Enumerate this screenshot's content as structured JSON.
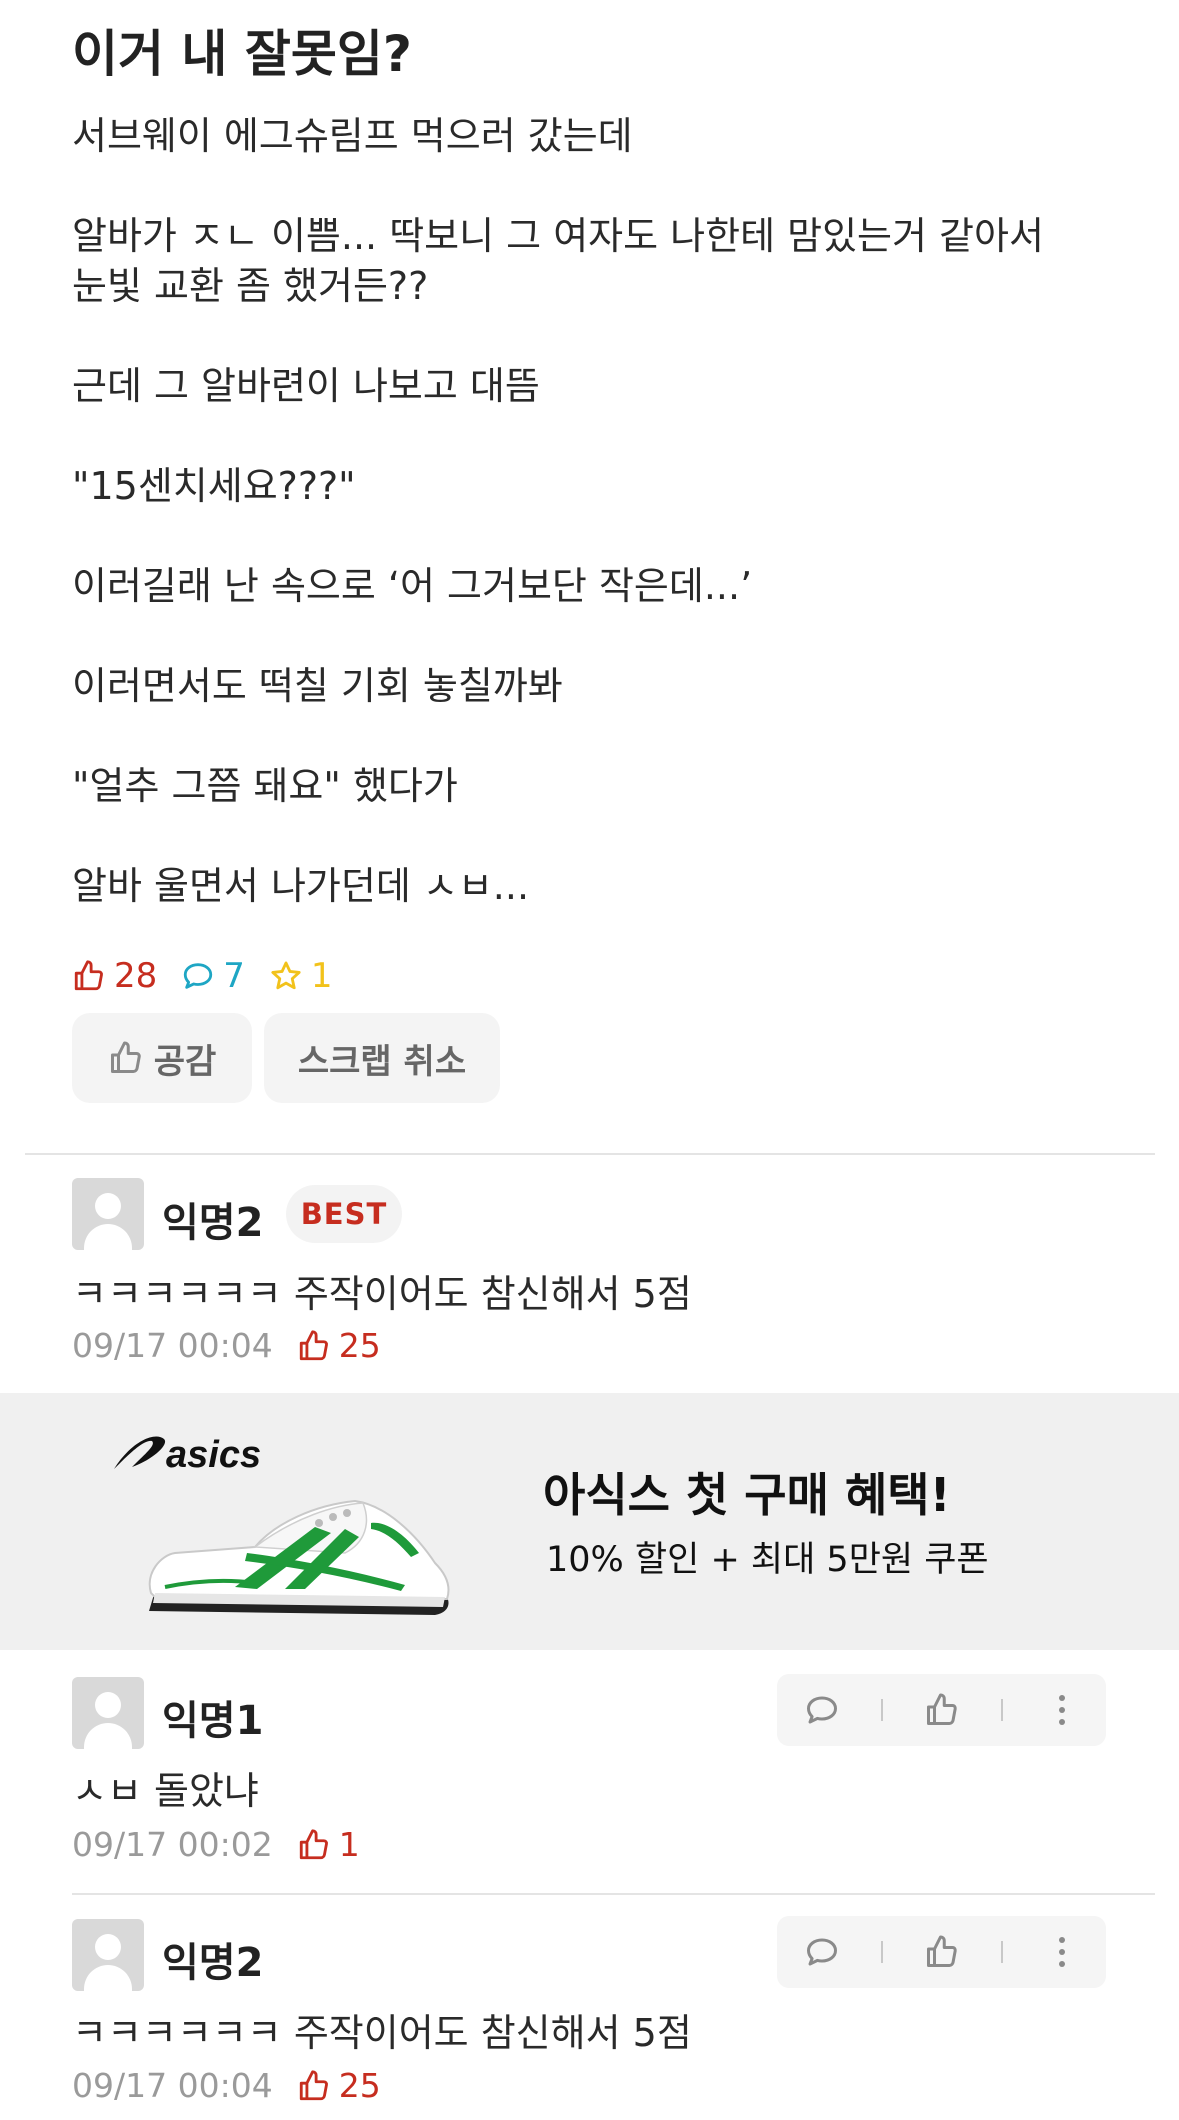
{
  "post": {
    "title": "이거 내 잘못임?",
    "lines": [
      "서브웨이 에그슈림프 먹으러 갔는데",
      "알바가 ㅈㄴ 이쁨... 딱보니 그 여자도 나한테 맘있는거 같아서",
      "눈빛 교환 좀 했거든??",
      "근데 그 알바련이 나보고 대뜸",
      "\"15센치세요???\"",
      "이러길래 난 속으로 ‘어 그거보단 작은데...’",
      "이러면서도 떡칠 기회 놓칠까봐",
      "\"얼추 그쯤 돼요\" 했다가",
      "알바 울면서 나가던데 ㅅㅂ..."
    ],
    "likes": "28",
    "comments": "7",
    "scraps": "1",
    "like_button": "공감",
    "scrap_button": "스크랩 취소"
  },
  "best_comment": {
    "author": "익명2",
    "badge": "BEST",
    "text": "ㅋㅋㅋㅋㅋㅋ 주작이어도 참신해서 5점",
    "time": "09/17 00:04",
    "likes": "25"
  },
  "ad": {
    "brand": "asics",
    "title": "아식스 첫 구매 혜택!",
    "subtitle": "10% 할인 + 최대 5만원 쿠폰"
  },
  "comments": [
    {
      "author": "익명1",
      "text": "ㅅㅂ 돌았냐",
      "time": "09/17 00:02",
      "likes": "1"
    },
    {
      "author": "익명2",
      "text": "ㅋㅋㅋㅋㅋㅋ 주작이어도 참신해서 5점",
      "time": "09/17 00:04",
      "likes": "25"
    }
  ],
  "colors": {
    "like": "#c62d1f",
    "comment": "#1ea6c4",
    "scrap": "#f2c21b",
    "meta_gray": "#9a9a9a",
    "shoe_green": "#1f9a3a"
  },
  "icons": [
    "thumbs-up-icon",
    "comment-icon",
    "star-icon",
    "more-icon",
    "avatar-icon",
    "shoe-image"
  ]
}
